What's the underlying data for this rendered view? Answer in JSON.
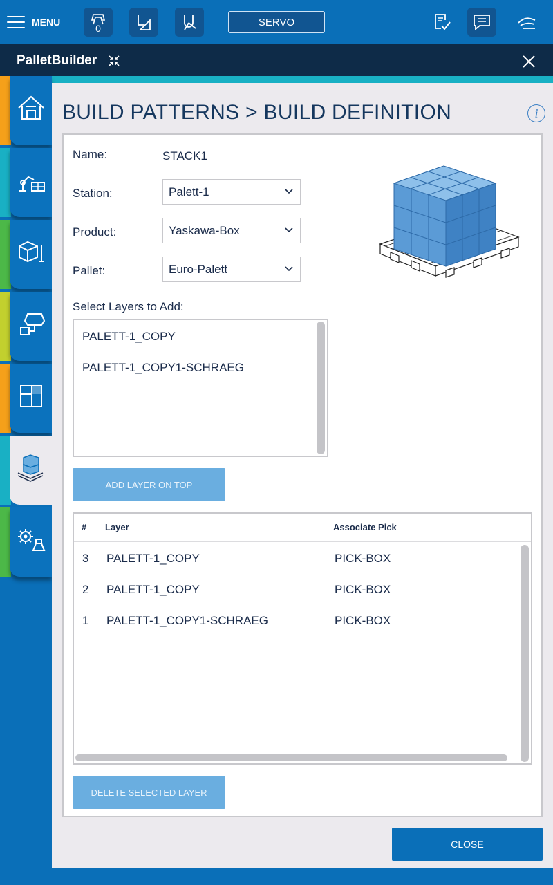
{
  "topbar": {
    "menu_label": "MENU",
    "tool_counter": "0",
    "servo_label": "SERVO",
    "icons": [
      "menu-icon",
      "gripper-tool-icon",
      "user-frame-icon",
      "robot-frame-icon",
      "job-check-icon",
      "message-icon",
      "hand-guide-icon"
    ]
  },
  "app": {
    "title": "PalletBuilder"
  },
  "sidebar": {
    "tabs": [
      {
        "icon": "home-icon",
        "accent": "#f5a01a"
      },
      {
        "icon": "robot-cell-icon",
        "accent": "#19b0c4"
      },
      {
        "icon": "box-definition-icon",
        "accent": "#4cb848"
      },
      {
        "icon": "pick-gripper-icon",
        "accent": "#c2d02e"
      },
      {
        "icon": "layer-pattern-icon",
        "accent": "#f5a01a"
      },
      {
        "icon": "build-pattern-icon",
        "accent": "#19b0c4"
      },
      {
        "icon": "settings-icon",
        "accent": "#4cb848"
      }
    ]
  },
  "page": {
    "title": "BUILD PATTERNS > BUILD DEFINITION"
  },
  "form": {
    "name_label": "Name:",
    "name_value": "STACK1",
    "station_label": "Station:",
    "station_value": "Palett-1",
    "product_label": "Product:",
    "product_value": "Yaskawa-Box",
    "pallet_label": "Pallet:",
    "pallet_value": "Euro-Palett",
    "select_layers_label": "Select Layers to Add:",
    "available_layers": [
      "PALETT-1_COPY",
      "PALETT-1_COPY1-SCHRAEG"
    ],
    "add_layer_button": "ADD LAYER ON TOP"
  },
  "table": {
    "headers": [
      "#",
      "Layer",
      "Associate Pick"
    ],
    "rows": [
      {
        "num": "3",
        "layer": "PALETT-1_COPY",
        "pick": "PICK-BOX"
      },
      {
        "num": "2",
        "layer": "PALETT-1_COPY",
        "pick": "PICK-BOX"
      },
      {
        "num": "1",
        "layer": "PALETT-1_COPY1-SCHRAEG",
        "pick": "PICK-BOX"
      }
    ]
  },
  "buttons": {
    "delete_layer": "DELETE SELECTED LAYER",
    "close": "CLOSE"
  },
  "colors": {
    "primary": "#0a6fb8",
    "titlebar": "#0e2b48",
    "teal": "#19b0c4",
    "disabled_button": "#6aaee0",
    "title_text": "#15375e"
  }
}
